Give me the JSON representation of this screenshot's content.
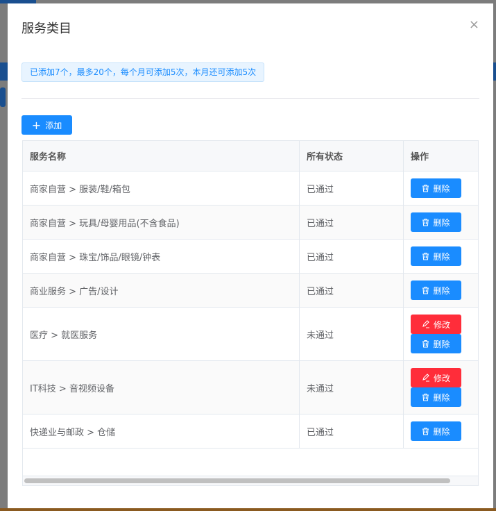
{
  "dialog": {
    "title": "服务类目",
    "close_icon": "×"
  },
  "notice": "已添加7个，最多20个，每个月可添加5次，本月还可添加5次",
  "add_button": {
    "icon": "+",
    "label": "添加"
  },
  "table": {
    "headers": [
      "服务名称",
      "所有状态",
      "操作"
    ],
    "rows": [
      {
        "name": "商家自营 > 服装/鞋/箱包",
        "status": "已通过",
        "actions": [
          "删除"
        ]
      },
      {
        "name": "商家自营 > 玩具/母婴用品(不含食品)",
        "status": "已通过",
        "actions": [
          "删除"
        ]
      },
      {
        "name": "商家自营 > 珠宝/饰品/眼镜/钟表",
        "status": "已通过",
        "actions": [
          "删除"
        ]
      },
      {
        "name": "商业服务 > 广告/设计",
        "status": "已通过",
        "actions": [
          "删除"
        ]
      },
      {
        "name": "医疗 > 就医服务",
        "status": "未通过",
        "actions": [
          "修改",
          "删除"
        ]
      },
      {
        "name": "IT科技 > 音视频设备",
        "status": "未通过",
        "actions": [
          "修改",
          "删除"
        ]
      },
      {
        "name": "快递业与邮政 > 仓储",
        "status": "已通过",
        "actions": [
          "删除"
        ]
      }
    ]
  },
  "colors": {
    "primary": "#1a8cff",
    "danger": "#ff2d3a"
  }
}
